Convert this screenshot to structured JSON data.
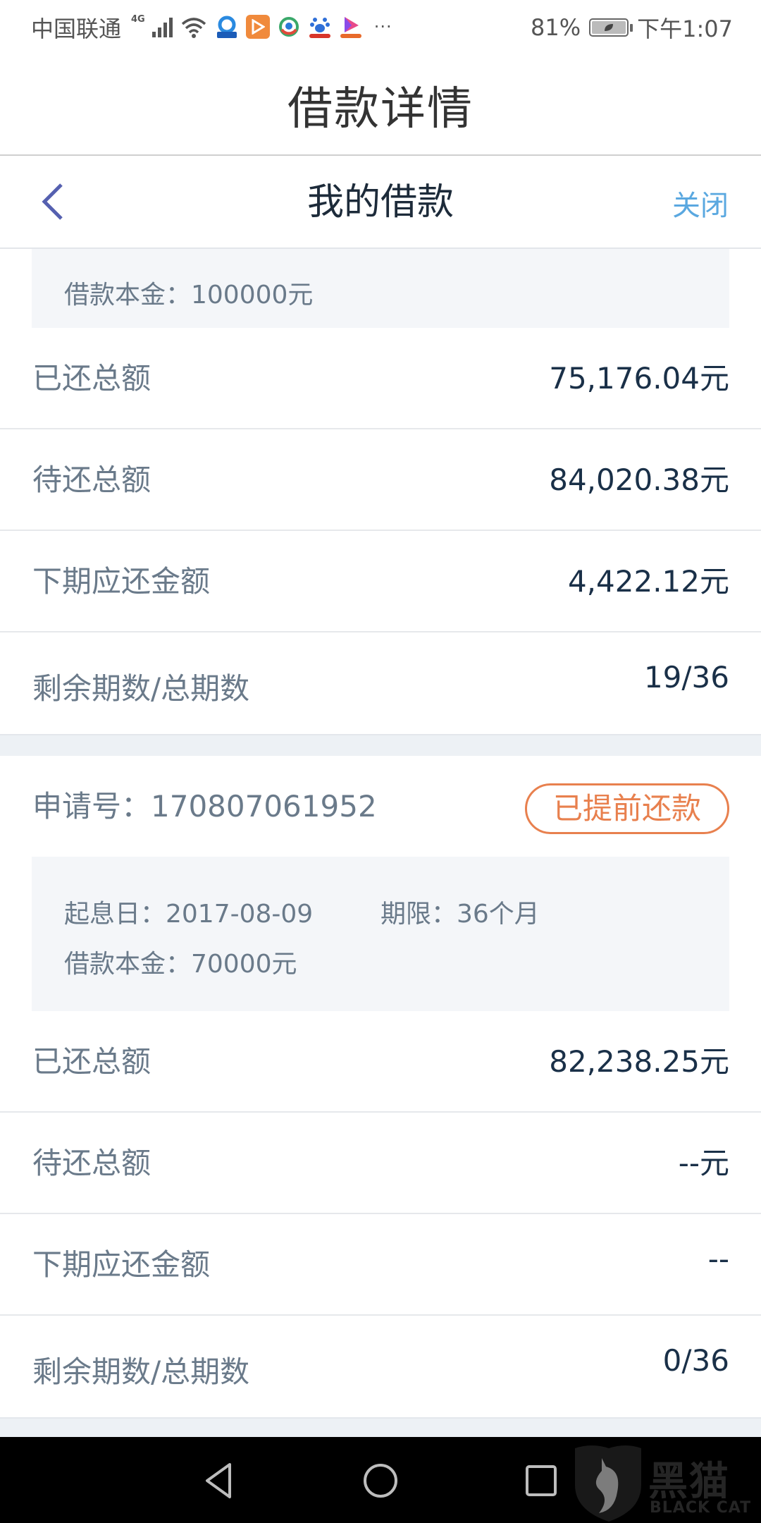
{
  "status_bar": {
    "carrier": "中国联通",
    "network": "4G",
    "more": "···",
    "battery_percent": "81%",
    "time": "下午1:07"
  },
  "title_bar": {
    "title": "借款详情"
  },
  "nav_bar": {
    "title": "我的借款",
    "close_label": "关闭",
    "back_icon": "chevron-left-icon"
  },
  "colors": {
    "accent_blue": "#5aa8e0",
    "back_icon": "#5560b0",
    "status_badge": "#e8804e",
    "label_text": "#6a7a8a",
    "value_text": "#1a3048"
  },
  "loans": [
    {
      "info": {
        "principal": "借款本金：100000元"
      },
      "rows": [
        {
          "label": "已还总额",
          "value": "75,176.04元"
        },
        {
          "label": "待还总额",
          "value": "84,020.38元"
        },
        {
          "label": "下期应还金额",
          "value": "4,422.12元"
        },
        {
          "label": "剩余期数/总期数",
          "value": "19/36"
        }
      ]
    },
    {
      "application_no": "申请号：170807061952",
      "status": "已提前还款",
      "info": {
        "start_date": "起息日：2017-08-09",
        "term": "期限：36个月",
        "principal": "借款本金：70000元"
      },
      "rows": [
        {
          "label": "已还总额",
          "value": "82,238.25元"
        },
        {
          "label": "待还总额",
          "value": "--元"
        },
        {
          "label": "下期应还金额",
          "value": "--"
        },
        {
          "label": "剩余期数/总期数",
          "value": "0/36"
        }
      ]
    }
  ],
  "watermark": {
    "text": "黑猫",
    "sub": "BLACK CAT"
  }
}
